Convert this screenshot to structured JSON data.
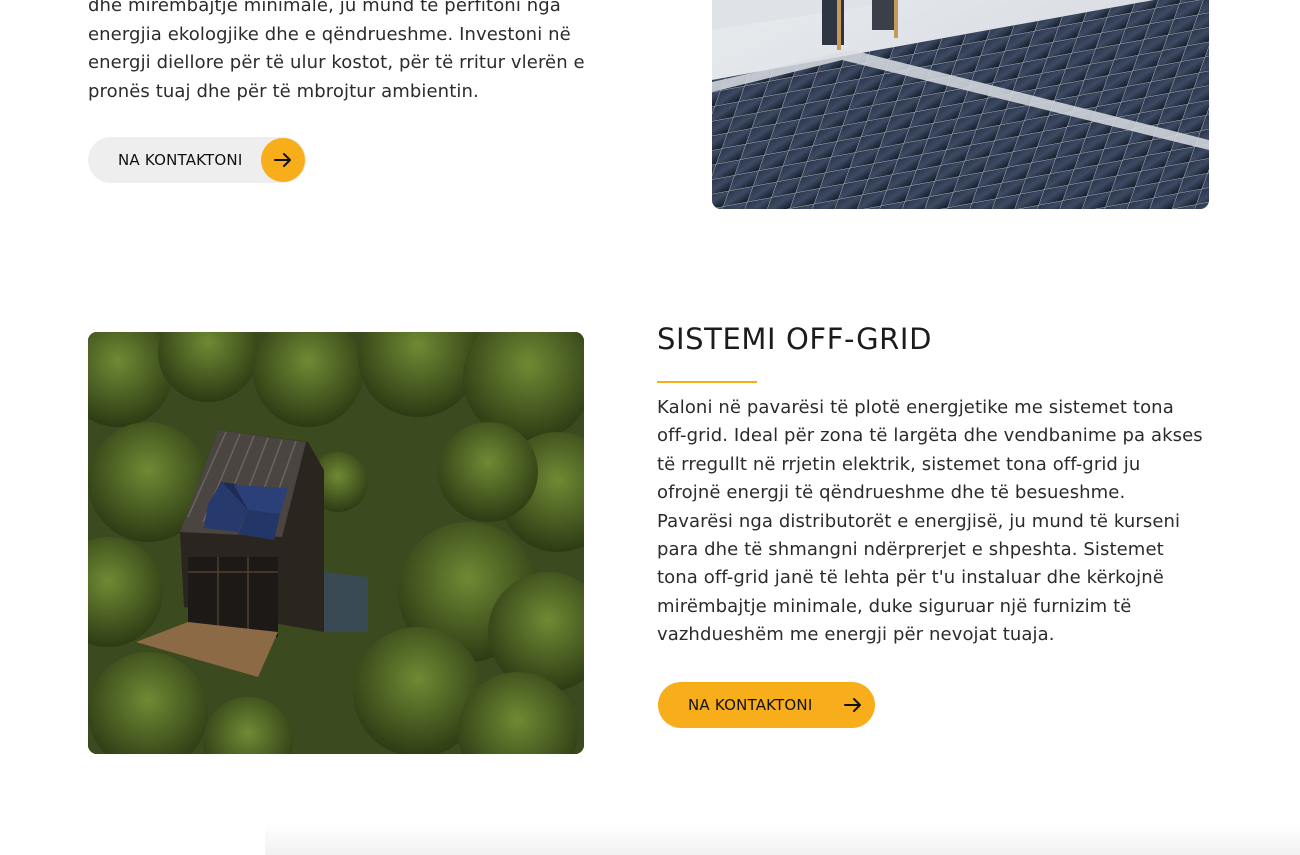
{
  "intro": {
    "paragraph": "dhe mirëmbajtje minimale, ju mund të përfitoni nga energjia ekologjike dhe e qëndrueshme. Investoni në energji diellore për të ulur kostot, për të rritur vlerën e pronës tuaj dhe për të mbrojtur ambientin.",
    "contact_label": "NA KONTAKTONI",
    "arrow_icon": "arrow-right-icon"
  },
  "offgrid": {
    "title": "SISTEMI OFF-GRID",
    "paragraph": "Kaloni në pavarësi të plotë energjetike me sistemet tona off-grid. Ideal për zona të largëta dhe vendbanime pa akses të rregullt në rrjetin elektrik, sistemet tona off-grid ju ofrojnë energji të qëndrueshme dhe të besueshme. Pavarësi nga distributorët e energjisë, ju mund të kurseni para dhe të shmangni ndërprerjet e shpeshta. Sistemet tona off-grid janë të lehta për t'u instaluar dhe kërkojnë mirëmbajtje minimale, duke siguruar një furnizim të vazhdueshëm me energji për nevojat tuaja.",
    "contact_label": "NA KONTAKTONI",
    "arrow_icon": "arrow-right-icon"
  },
  "colors": {
    "accent": "#f8ad1b",
    "button_grey": "#eeeeee",
    "text": "#2b2b2b"
  }
}
